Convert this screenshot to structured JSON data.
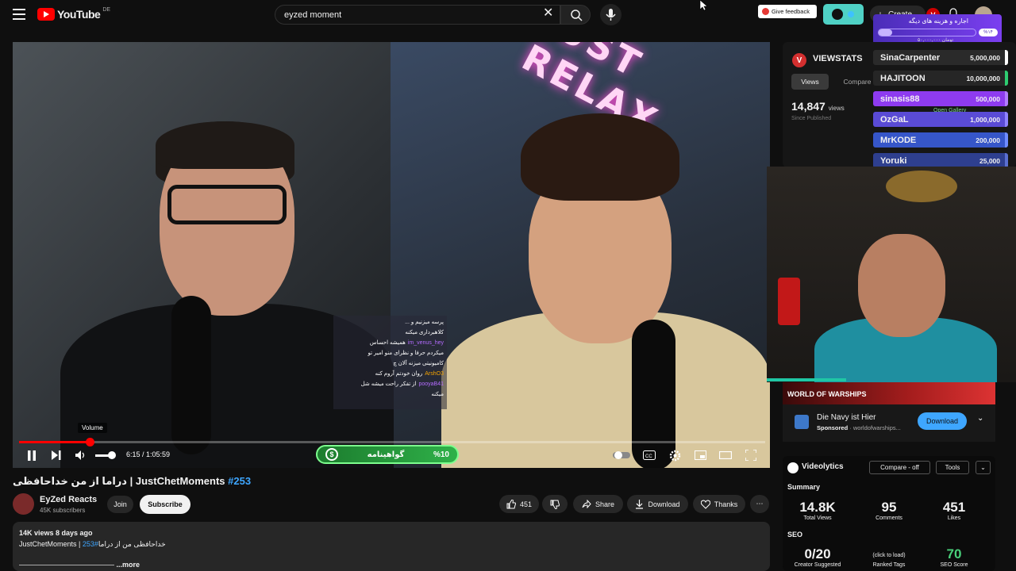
{
  "header": {
    "logo_word": "YouTube",
    "logo_country": "DE",
    "search_value": "eyzed moment",
    "feedback_label": "Give feedback",
    "create_label": "Create",
    "ext_badge": "V"
  },
  "donation": {
    "title": "اجاره و هزینه های دیگه",
    "percent": "%۱۴",
    "amount": "۵۰,۰۰۰,۰۰۰ تومان",
    "progress": 0.14
  },
  "video": {
    "neon_text": "JUST RELAX",
    "volume_tooltip": "Volume",
    "time": "6:15 / 1:05:59",
    "progress": 0.095,
    "volume": 0.7,
    "promo_left": "گواهینامه",
    "promo_right": "%10",
    "chat": [
      {
        "name": "",
        "text": "پرسه میزنیم و ..."
      },
      {
        "name": "",
        "text": "کلاهبرداری میکنه"
      },
      {
        "name": "im_venus_hey",
        "text": "همیشه احساس"
      },
      {
        "name": "",
        "text": "میکردم حرفا و نظرای منو امیر تو"
      },
      {
        "name": "",
        "text": "کامیونیتی میزنه آلان چ"
      },
      {
        "name": "ArshO3",
        "text": "روان خودتم آروم کنه"
      },
      {
        "name": "pooyaB41",
        "text": "از تفکر راحت میشه شل"
      },
      {
        "name": "",
        "text": "میکنه"
      }
    ]
  },
  "meta": {
    "title_main": "دراما از من خداحافظی | JustChetMoments",
    "title_hash": "#253",
    "channel_name": "EyZed Reacts",
    "subscribers": "45K subscribers",
    "join_label": "Join",
    "subscribe_label": "Subscribe",
    "likes": "451",
    "share_label": "Share",
    "download_label": "Download",
    "thanks_label": "Thanks",
    "views_date": "14K views  8 days ago",
    "desc_line": "JustChetMoments | خداحافظی من از دراما",
    "desc_hash": "#253",
    "more_label": "...more"
  },
  "viewstats": {
    "title": "VIEWSTATS",
    "logo": "V",
    "tab_views": "Views",
    "tab_compare": "Compare",
    "views": "14,847",
    "views_unit": "views",
    "since": "Since Published",
    "gallery_label": "Open Gallery"
  },
  "leaderboard": [
    {
      "name": "SinaCarpenter",
      "amount": "5,000,000",
      "bg": "#2a2a2a",
      "bar": "#ffffff"
    },
    {
      "name": "HAJITOON",
      "amount": "10,000,000",
      "bg": "#262626",
      "bar": "#2ecc71"
    },
    {
      "name": "sinasis88",
      "amount": "500,000",
      "bg": "#8e3bf0",
      "bar": "#b27dff"
    },
    {
      "name": "OzGaL",
      "amount": "1,000,000",
      "bg": "#5a4bd6",
      "bar": "#8f83ff"
    },
    {
      "name": "MrKODE",
      "amount": "200,000",
      "bg": "#3656c9",
      "bar": "#6f8cff"
    },
    {
      "name": "Yoruki",
      "amount": "25,000",
      "bg": "#2e3f8f",
      "bar": "#5a6fd0"
    }
  ],
  "ad": {
    "banner": "WORLD OF WARSHIPS",
    "title": "Die Navy ist Hier",
    "sponsored": "Sponsored",
    "domain": "worldofwarships...",
    "download_label": "Download"
  },
  "videolytics": {
    "title": "Videolytics",
    "compare_label": "Compare - off",
    "tools_label": "Tools",
    "summary_label": "Summary",
    "total_views": "14.8K",
    "total_views_label": "Total Views",
    "comments": "95",
    "comments_label": "Comments",
    "likes": "451",
    "likes_label": "Likes",
    "seo_label": "SEO",
    "creator_tags": "0/20",
    "creator_tags_label": "Creator Suggested",
    "click_load": "(click to load)",
    "ranked_label": "Ranked Tags",
    "seo_score": "70",
    "seo_score_label": "SEO Score"
  },
  "colors": {
    "accent_red": "#ff0000",
    "link_blue": "#3ea6ff",
    "ext_teal": "#4fd1c5"
  }
}
